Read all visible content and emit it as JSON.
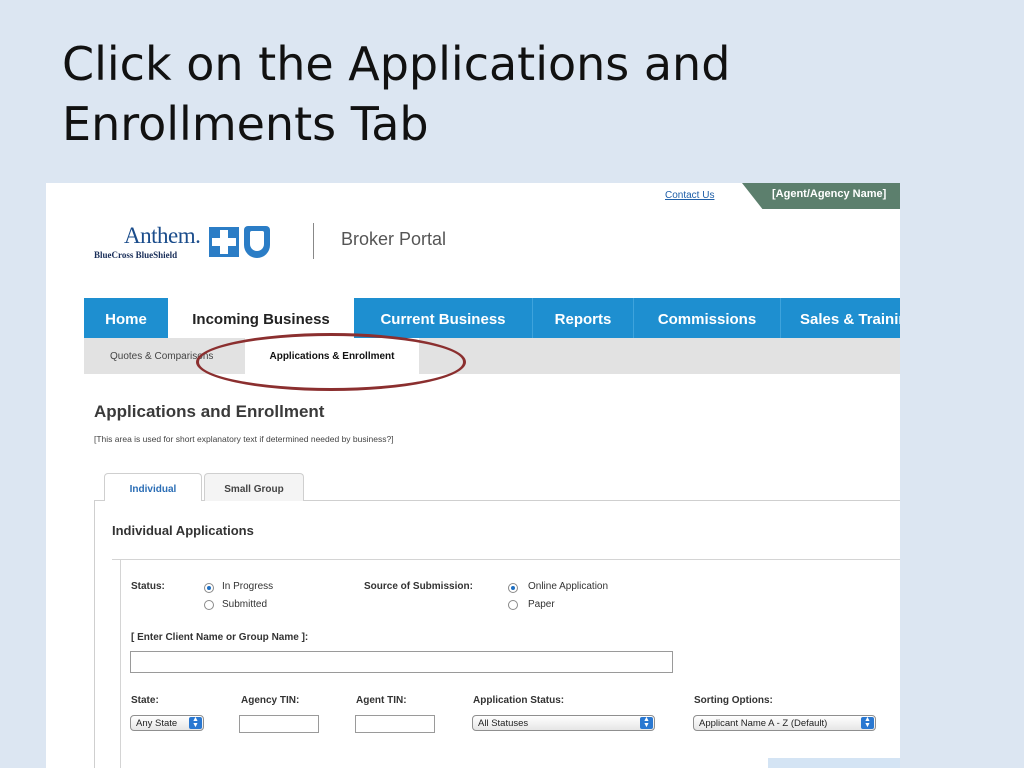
{
  "slide": {
    "title": "Click on the Applications and Enrollments Tab"
  },
  "header": {
    "contact_link": "Contact Us",
    "agent_name": "[Agent/Agency Name]",
    "logo_word": "Anthem.",
    "logo_sub": "BlueCross BlueShield",
    "portal_title": "Broker Portal"
  },
  "nav": {
    "items": [
      {
        "label": "Home"
      },
      {
        "label": "Incoming Business",
        "active": true
      },
      {
        "label": "Current Business"
      },
      {
        "label": "Reports"
      },
      {
        "label": "Commissions"
      },
      {
        "label": "Sales & Training"
      }
    ]
  },
  "subnav": {
    "items": [
      {
        "label": "Quotes & Comparisons"
      },
      {
        "label": "Applications & Enrollment",
        "active": true
      }
    ]
  },
  "page": {
    "heading": "Applications and Enrollment",
    "description": "[This area is used for short explanatory text if determined needed by business?]"
  },
  "tabs": [
    {
      "label": "Individual",
      "active": true
    },
    {
      "label": "Small Group"
    }
  ],
  "panel": {
    "title": "Individual Applications",
    "status": {
      "label": "Status:",
      "options": [
        "In Progress",
        "Submitted"
      ],
      "selected": "In Progress"
    },
    "source": {
      "label": "Source of Submission:",
      "options": [
        "Online Application",
        "Paper"
      ],
      "selected": "Online Application"
    },
    "client_search": {
      "label": "[ Enter Client Name or Group Name ]:",
      "value": ""
    },
    "state": {
      "label": "State:",
      "value": "Any State"
    },
    "agency_tin": {
      "label": "Agency TIN:",
      "value": ""
    },
    "agent_tin": {
      "label": "Agent TIN:",
      "value": ""
    },
    "app_status": {
      "label": "Application Status:",
      "value": "All Statuses"
    },
    "sorting": {
      "label": "Sorting Options:",
      "value": "Applicant Name A - Z (Default)"
    }
  },
  "colors": {
    "nav_blue": "#1e8fd0",
    "agent_tab_green": "#5c7f6d",
    "highlight_ellipse": "#8b2f2f",
    "slide_background": "#dce6f2"
  }
}
